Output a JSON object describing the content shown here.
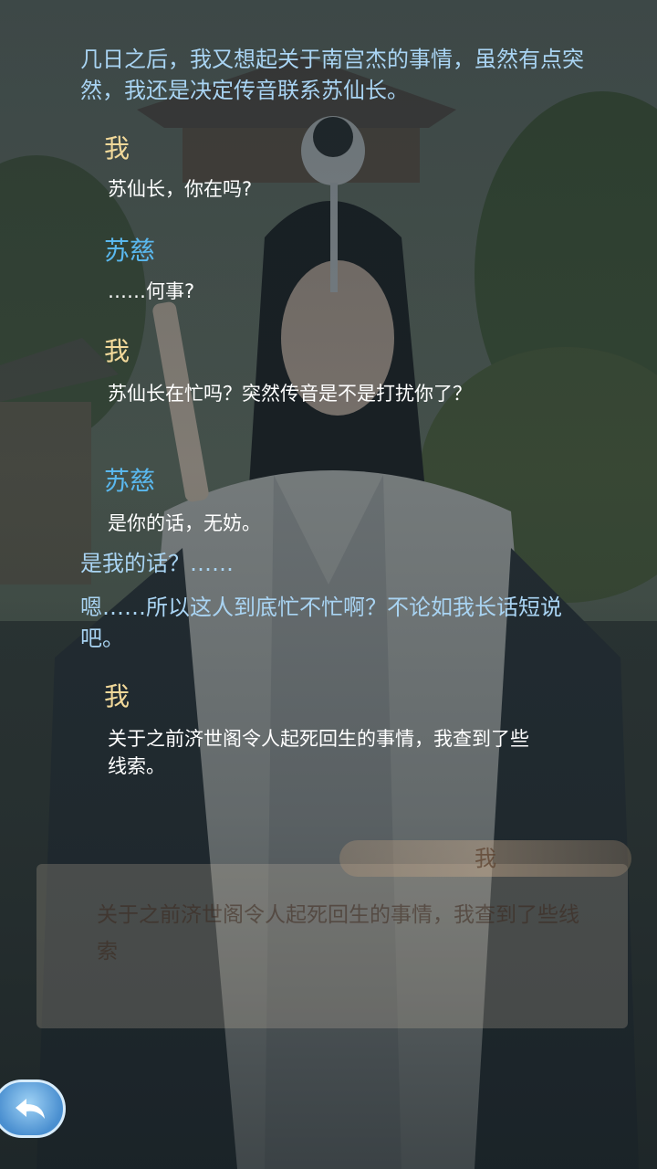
{
  "log": [
    {
      "type": "narration",
      "text": "几日之后，我又想起关于南宫杰的事情，虽然有点突然，我还是决定传音联系苏仙长。"
    },
    {
      "type": "speaker",
      "who": "me",
      "name": "我"
    },
    {
      "type": "line",
      "text": "苏仙长，你在吗?"
    },
    {
      "type": "speaker",
      "who": "suci",
      "name": "苏慈"
    },
    {
      "type": "line",
      "text": "……何事?"
    },
    {
      "type": "speaker",
      "who": "me",
      "name": "我"
    },
    {
      "type": "line",
      "text": "苏仙长在忙吗？突然传音是不是打扰你了？"
    },
    {
      "type": "speaker",
      "who": "suci",
      "name": "苏慈"
    },
    {
      "type": "line",
      "text": "是你的话，无妨。"
    },
    {
      "type": "narration",
      "text": "是我的话？……"
    },
    {
      "type": "narration",
      "text": "嗯……所以这人到底忙不忙啊？不论如我长话短说吧。"
    },
    {
      "type": "speaker",
      "who": "me",
      "name": "我"
    },
    {
      "type": "line",
      "text": "关于之前济世阁令人起死回生的事情，我查到了些线索。"
    }
  ],
  "dialog": {
    "speaker": "我",
    "text": "关于之前济世阁令人起死回生的事情，我查到了些线索"
  },
  "back_button": {
    "icon": "back-arrow-icon"
  },
  "colors": {
    "narration": "#a9d4f3",
    "speaker_me": "#f2d99a",
    "speaker_suci": "#5ab8ee",
    "line": "#ffffff"
  }
}
